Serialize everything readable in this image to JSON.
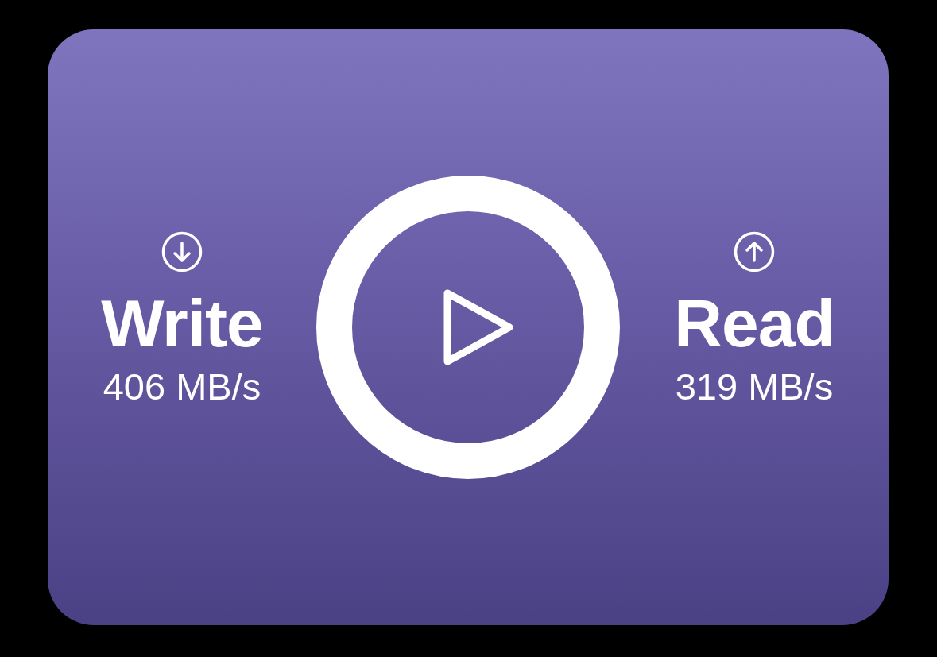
{
  "metrics": [
    {
      "kind": "write",
      "label": "Write",
      "speed": "406 MB/s"
    },
    {
      "kind": "read",
      "label": "Read",
      "speed": "319 MB/s"
    }
  ]
}
